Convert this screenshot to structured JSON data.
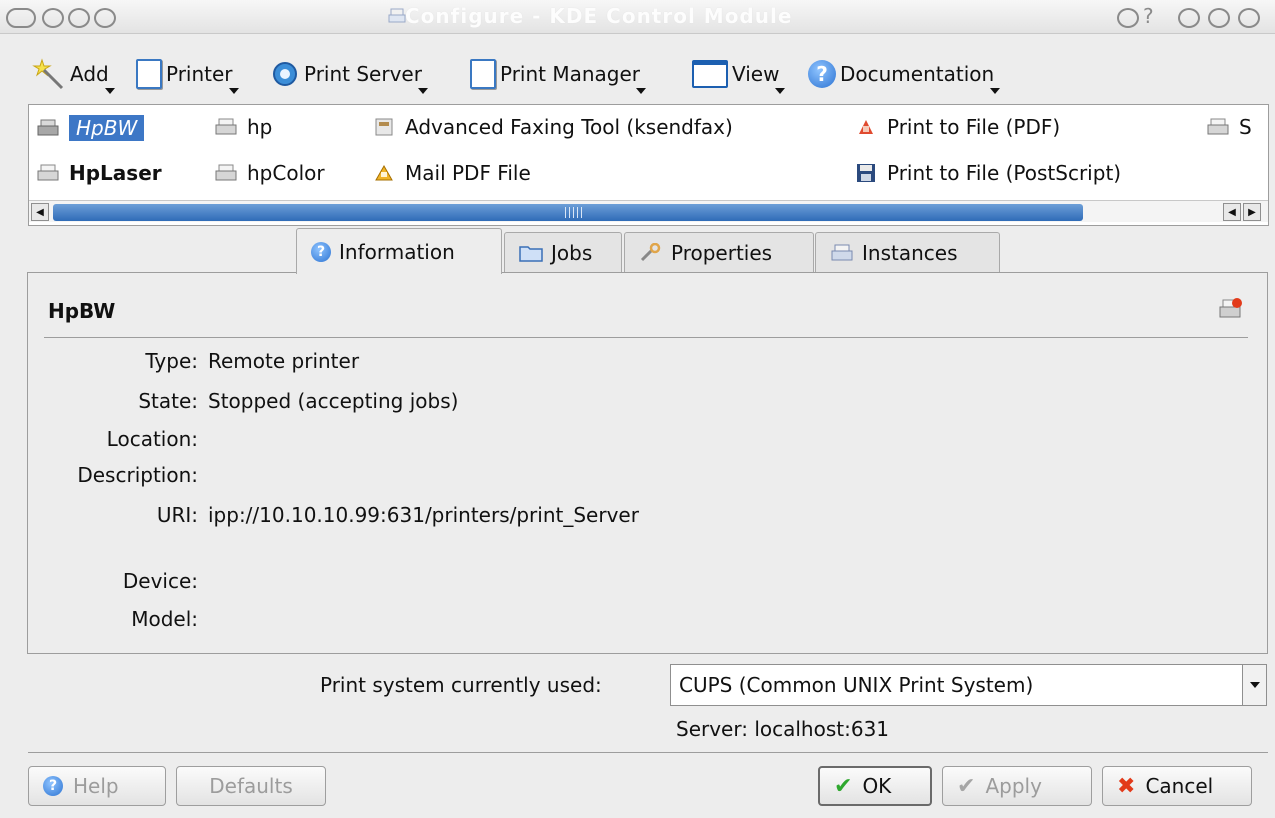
{
  "window": {
    "title": "Configure - KDE Control Module",
    "help_glyph": "?"
  },
  "toolbar": {
    "add": "Add",
    "printer": "Printer",
    "print_server": "Print Server",
    "print_manager": "Print Manager",
    "view": "View",
    "documentation": "Documentation"
  },
  "printers": {
    "items": [
      {
        "label": "HpBW",
        "selected": true
      },
      {
        "label": "hp"
      },
      {
        "label": "Advanced Faxing Tool (ksendfax)"
      },
      {
        "label": "Print to File (PDF)"
      },
      {
        "label": "S"
      },
      {
        "label": "HpLaser",
        "default": true
      },
      {
        "label": "hpColor"
      },
      {
        "label": "Mail PDF File"
      },
      {
        "label": "Print to File (PostScript)"
      }
    ]
  },
  "tabs": [
    {
      "label": "Information",
      "active": true
    },
    {
      "label": "Jobs"
    },
    {
      "label": "Properties"
    },
    {
      "label": "Instances"
    }
  ],
  "info": {
    "printer_name": "HpBW",
    "fields": [
      {
        "label": "Type:",
        "value": "Remote printer"
      },
      {
        "label": "State:",
        "value": "Stopped (accepting jobs)"
      },
      {
        "label": "Location:",
        "value": ""
      },
      {
        "label": "Description:",
        "value": ""
      },
      {
        "label": "URI:",
        "value": "ipp://10.10.10.99:631/printers/print_Server"
      },
      {
        "label": "Device:",
        "value": ""
      },
      {
        "label": "Model:",
        "value": ""
      }
    ]
  },
  "print_system": {
    "label": "Print system currently used:",
    "selected": "CUPS (Common UNIX Print System)",
    "server": "Server: localhost:631"
  },
  "buttons": {
    "help": "Help",
    "defaults": "Defaults",
    "ok": "OK",
    "apply": "Apply",
    "cancel": "Cancel"
  },
  "colors": {
    "selection": "#3d77c6",
    "window_bg": "#ededed",
    "ok_check": "#2fa82f",
    "cancel_x": "#e23a1a"
  }
}
